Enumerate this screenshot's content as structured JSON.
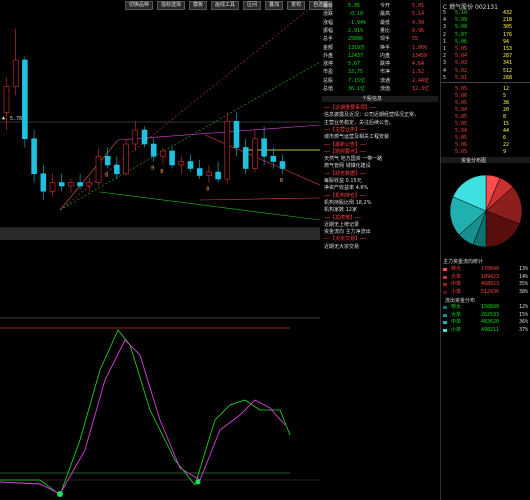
{
  "toolbar": {
    "buttons": [
      "切换品种",
      "指标选择",
      "模板",
      "画线工具",
      "区间",
      "叠加",
      "复权",
      "自选股"
    ]
  },
  "chart": {
    "price_label": "5.78",
    "bars": [
      {
        "o": 5.3,
        "h": 5.5,
        "l": 5.2,
        "c": 5.45
      },
      {
        "o": 5.45,
        "h": 5.78,
        "l": 5.4,
        "c": 5.6
      },
      {
        "o": 5.6,
        "h": 5.62,
        "l": 5.1,
        "c": 5.15
      },
      {
        "o": 5.15,
        "h": 5.2,
        "l": 4.9,
        "c": 4.95
      },
      {
        "o": 4.95,
        "h": 5.0,
        "l": 4.8,
        "c": 4.85
      },
      {
        "o": 4.85,
        "h": 4.95,
        "l": 4.82,
        "c": 4.9
      },
      {
        "o": 4.9,
        "h": 4.95,
        "l": 4.85,
        "c": 4.88
      },
      {
        "o": 4.88,
        "h": 4.92,
        "l": 4.84,
        "c": 4.9
      },
      {
        "o": 4.9,
        "h": 4.95,
        "l": 4.86,
        "c": 4.88
      },
      {
        "o": 4.88,
        "h": 4.93,
        "l": 4.85,
        "c": 4.9
      },
      {
        "o": 4.9,
        "h": 5.1,
        "l": 4.88,
        "c": 5.05
      },
      {
        "o": 5.05,
        "h": 5.1,
        "l": 4.98,
        "c": 5.0
      },
      {
        "o": 5.0,
        "h": 5.05,
        "l": 4.92,
        "c": 4.95
      },
      {
        "o": 4.95,
        "h": 5.15,
        "l": 4.94,
        "c": 5.12
      },
      {
        "o": 5.12,
        "h": 5.25,
        "l": 5.08,
        "c": 5.2
      },
      {
        "o": 5.2,
        "h": 5.22,
        "l": 5.1,
        "c": 5.12
      },
      {
        "o": 5.12,
        "h": 5.15,
        "l": 5.02,
        "c": 5.05
      },
      {
        "o": 5.05,
        "h": 5.1,
        "l": 5.0,
        "c": 5.08
      },
      {
        "o": 5.08,
        "h": 5.1,
        "l": 4.98,
        "c": 5.0
      },
      {
        "o": 5.0,
        "h": 5.05,
        "l": 4.95,
        "c": 5.02
      },
      {
        "o": 5.02,
        "h": 5.06,
        "l": 4.96,
        "c": 4.98
      },
      {
        "o": 4.98,
        "h": 5.03,
        "l": 4.92,
        "c": 4.94
      },
      {
        "o": 4.94,
        "h": 5.0,
        "l": 4.9,
        "c": 4.96
      },
      {
        "o": 4.96,
        "h": 5.02,
        "l": 4.9,
        "c": 4.92
      },
      {
        "o": 4.92,
        "h": 5.3,
        "l": 4.9,
        "c": 5.25
      },
      {
        "o": 5.25,
        "h": 5.3,
        "l": 5.05,
        "c": 5.1
      },
      {
        "o": 5.1,
        "h": 5.15,
        "l": 4.95,
        "c": 4.98
      },
      {
        "o": 4.98,
        "h": 5.2,
        "l": 4.96,
        "c": 5.15
      },
      {
        "o": 5.15,
        "h": 5.22,
        "l": 5.0,
        "c": 5.05
      },
      {
        "o": 5.05,
        "h": 5.1,
        "l": 4.98,
        "c": 5.02
      },
      {
        "o": 5.02,
        "h": 5.06,
        "l": 4.95,
        "c": 4.98
      }
    ],
    "signal_labels": [
      "B",
      "B",
      "B",
      "B",
      "B"
    ]
  },
  "quote": {
    "rows": [
      {
        "a": "最新",
        "b": "5.05",
        "c": "今开",
        "d": "5.05"
      },
      {
        "a": "涨跌",
        "b": "-0.10",
        "c": "最高",
        "d": "5.14"
      },
      {
        "a": "涨幅",
        "b": "-1.94%",
        "c": "最低",
        "d": "4.99"
      },
      {
        "a": "振幅",
        "b": "2.91%",
        "c": "量比",
        "d": "0.96"
      },
      {
        "a": "总手",
        "b": "25896",
        "c": "现手",
        "d": "55"
      },
      {
        "a": "金额",
        "b": "1319万",
        "c": "换手",
        "d": "1.06%"
      },
      {
        "a": "外盘",
        "b": "12437",
        "c": "内盘",
        "d": "13459"
      },
      {
        "a": "涨停",
        "b": "5.67",
        "c": "跌停",
        "d": "4.64"
      },
      {
        "a": "市盈",
        "b": "33.75",
        "c": "市净",
        "d": "1.52"
      },
      {
        "a": "总股",
        "b": "7.15亿",
        "c": "流通",
        "d": "2.44亿"
      },
      {
        "a": "总值",
        "b": "36.1亿",
        "c": "流值",
        "d": "12.3亿"
      }
    ]
  },
  "info": {
    "header": "个股信息",
    "lines": [
      "──【近期重要事项】──",
      "信息披露及近况：公司近期经营情况正常，",
      "主营业务稳定，关注后续公告。",
      "──【主营业务】──",
      "城市燃气运营及相关工程安装",
      "──【最新公告】──",
      "──【题材要点】──",
      "天然气 地方国资 一带一路",
      "燃气管网 城镇化建设",
      "──【财务数据】──",
      "每股收益 0.15元",
      "净资产收益率 4.6%",
      "──【机构持仓】──",
      "机构持股比例 18.2%",
      "机构家数 12家",
      "──【龙虎榜】──",
      "近期无上榜记录",
      "资金流向 主力净流出",
      "──【大宗交易】──",
      "近期无大宗交易"
    ]
  },
  "right": {
    "title": "C 燃气股份 002131",
    "orderbook": [
      {
        "n": "5",
        "p": "5.10",
        "v": "432"
      },
      {
        "n": "4",
        "p": "5.09",
        "v": "218"
      },
      {
        "n": "3",
        "p": "5.08",
        "v": "305"
      },
      {
        "n": "2",
        "p": "5.07",
        "v": "176"
      },
      {
        "n": "1",
        "p": "5.06",
        "v": "94"
      },
      {
        "n": "1",
        "p": "5.05",
        "v": "153"
      },
      {
        "n": "2",
        "p": "5.04",
        "v": "287"
      },
      {
        "n": "3",
        "p": "5.03",
        "v": "341"
      },
      {
        "n": "4",
        "p": "5.02",
        "v": "512"
      },
      {
        "n": "5",
        "p": "5.01",
        "v": "268"
      }
    ],
    "trades": [
      {
        "p": "5.05",
        "v": "12"
      },
      {
        "p": "5.06",
        "v": "5"
      },
      {
        "p": "5.05",
        "v": "38"
      },
      {
        "p": "5.04",
        "v": "20"
      },
      {
        "p": "5.05",
        "v": "8"
      },
      {
        "p": "5.05",
        "v": "15"
      },
      {
        "p": "5.04",
        "v": "44"
      },
      {
        "p": "5.05",
        "v": "6"
      },
      {
        "p": "5.06",
        "v": "22"
      },
      {
        "p": "5.05",
        "v": "9"
      }
    ],
    "pie_title": "资金分布图",
    "flow_title": "主力资金流向统计",
    "flow_in": [
      {
        "k": "特大",
        "v": "170848",
        "p": "13%"
      },
      {
        "k": "大单",
        "v": "189423",
        "p": "14%"
      },
      {
        "k": "中单",
        "v": "468923",
        "p": "35%"
      },
      {
        "k": "小单",
        "v": "512036",
        "p": "38%"
      }
    ],
    "flow_out_title": "流出资金分布",
    "flow_out": [
      {
        "k": "特大",
        "v": "158890",
        "p": "12%"
      },
      {
        "k": "大单",
        "v": "202533",
        "p": "15%"
      },
      {
        "k": "中单",
        "v": "483620",
        "p": "36%"
      },
      {
        "k": "小单",
        "v": "498211",
        "p": "37%"
      }
    ],
    "pie_colors": [
      "#ff4d4d",
      "#c83232",
      "#8c1e1e",
      "#5a0f0f",
      "#107070",
      "#189090",
      "#20b0b0",
      "#40e0e0"
    ]
  }
}
